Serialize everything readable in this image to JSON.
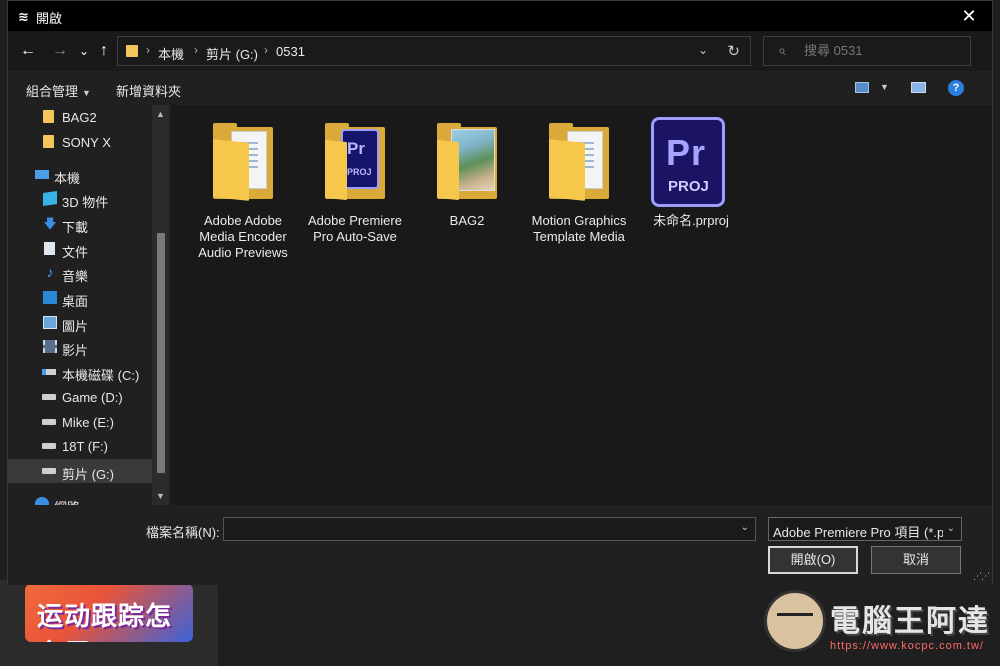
{
  "window": {
    "title": "開啟",
    "close_glyph": "✕"
  },
  "nav": {
    "back_glyph": "←",
    "forward_glyph": "→",
    "recent_glyph": "⌄",
    "up_glyph": "↑",
    "breadcrumbs": [
      "本機",
      "剪片 (G:)",
      "0531"
    ],
    "separator": "›",
    "refresh_glyph": "↻",
    "dropdown_glyph": "⌄"
  },
  "search": {
    "placeholder": "搜尋 0531",
    "icon": "⌕"
  },
  "toolbar": {
    "organize_label": "組合管理",
    "new_folder_label": "新增資料夾",
    "help_label": "?"
  },
  "sidebar": {
    "items": [
      {
        "label": "BAG2",
        "icon": "folder-icon"
      },
      {
        "label": "SONY X",
        "icon": "folder-icon"
      },
      {
        "label": "本機",
        "icon": "computer-icon"
      },
      {
        "label": "3D 物件",
        "icon": "cube-icon"
      },
      {
        "label": "下載",
        "icon": "download-icon",
        "glyph": "🡇"
      },
      {
        "label": "文件",
        "icon": "document-icon"
      },
      {
        "label": "音樂",
        "icon": "music-icon",
        "glyph": "♪"
      },
      {
        "label": "桌面",
        "icon": "desktop-icon"
      },
      {
        "label": "圖片",
        "icon": "pictures-icon"
      },
      {
        "label": "影片",
        "icon": "videos-icon"
      },
      {
        "label": "本機磁碟 (C:)",
        "icon": "drive-c-icon"
      },
      {
        "label": "Game (D:)",
        "icon": "drive-icon"
      },
      {
        "label": "Mike (E:)",
        "icon": "drive-icon"
      },
      {
        "label": "18T (F:)",
        "icon": "drive-icon"
      },
      {
        "label": "剪片 (G:)",
        "icon": "drive-icon",
        "selected": true
      },
      {
        "label": "網路",
        "icon": "network-icon"
      }
    ],
    "scroll_up_glyph": "▲",
    "scroll_down_glyph": "▼"
  },
  "files": [
    {
      "name": "Adobe Adobe Media Encoder Audio Previews",
      "kind": "folder-docs"
    },
    {
      "name": "Adobe Premiere Pro Auto-Save",
      "kind": "folder-premiere",
      "pr_text": "Pr",
      "proj_text": "PROJ"
    },
    {
      "name": "BAG2",
      "kind": "folder-photo"
    },
    {
      "name": "Motion Graphics Template Media",
      "kind": "folder-docs"
    },
    {
      "name": "未命名.prproj",
      "kind": "premiere-file",
      "pr_text": "Pr",
      "proj_text": "PROJ"
    }
  ],
  "bottom": {
    "filename_label": "檔案名稱(N):",
    "filename_value": "",
    "filetype_value": "Adobe Premiere Pro 項目 (*.prproj)",
    "open_label": "開啟(O)",
    "cancel_label": "取消",
    "dropdown_glyph": "⌄"
  },
  "background": {
    "thumbnail_text": "运动跟踪怎么用?",
    "watermark_text": "電腦王阿達",
    "watermark_url": "https://www.kocpc.com.tw/"
  }
}
